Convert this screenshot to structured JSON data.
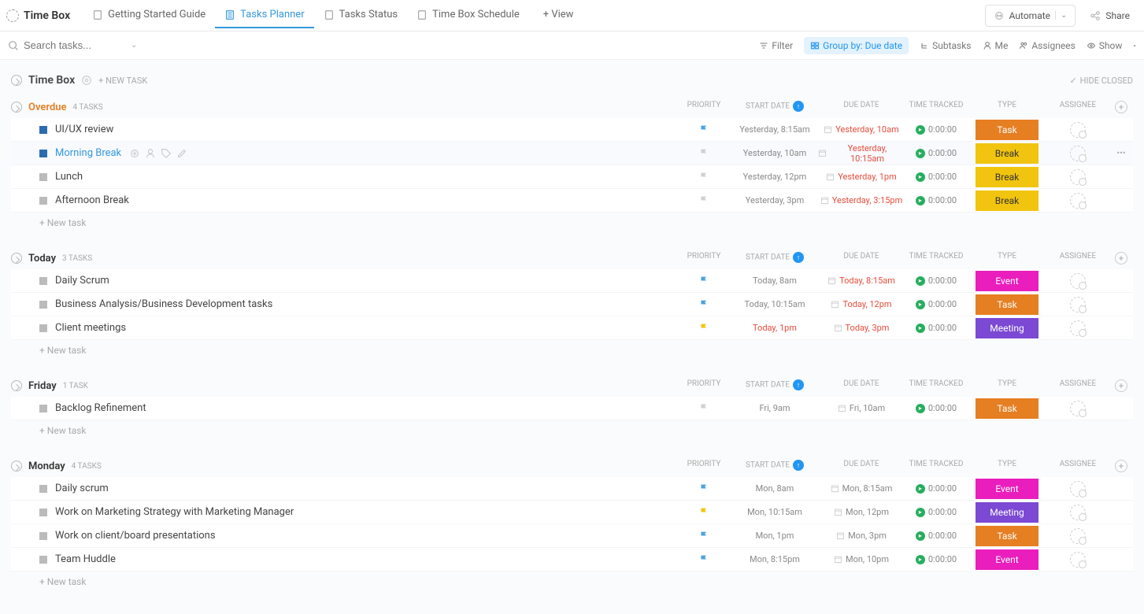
{
  "app": {
    "title": "Time Box"
  },
  "tabs": [
    {
      "label": "Getting Started Guide"
    },
    {
      "label": "Tasks Planner"
    },
    {
      "label": "Tasks Status"
    },
    {
      "label": "Time Box Schedule"
    }
  ],
  "addView": "+ View",
  "topRight": {
    "automate": "Automate",
    "share": "Share"
  },
  "search": {
    "placeholder": "Search tasks..."
  },
  "toolbar": {
    "filter": "Filter",
    "groupBy": "Group by: Due date",
    "subtasks": "Subtasks",
    "me": "Me",
    "assignees": "Assignees",
    "show": "Show"
  },
  "list": {
    "title": "Time Box",
    "newTask": "+ NEW TASK",
    "hideClosed": "HIDE CLOSED"
  },
  "columns": {
    "priority": "PRIORITY",
    "startDate": "START DATE",
    "dueDate": "DUE DATE",
    "timeTracked": "TIME TRACKED",
    "type": "TYPE",
    "assignee": "ASSIGNEE"
  },
  "newTaskRow": "+ New task",
  "groups": [
    {
      "name": "Overdue",
      "nameClass": "overdue",
      "count": "4 TASKS",
      "tasks": [
        {
          "name": "UI/UX review",
          "status": "blue",
          "flag": "blue",
          "start": "Yesterday, 8:15am",
          "due": "Yesterday, 10am",
          "dueRed": true,
          "time": "0:00:00",
          "type": "Task",
          "typeClass": "type-task"
        },
        {
          "name": "Morning Break",
          "status": "blue",
          "flag": "gray",
          "start": "Yesterday, 10am",
          "due": "Yesterday, 10:15am",
          "dueRed": true,
          "time": "0:00:00",
          "type": "Break",
          "typeClass": "type-break",
          "hover": true,
          "actions": true,
          "more": true,
          "link": true
        },
        {
          "name": "Lunch",
          "status": "gray",
          "flag": "gray",
          "start": "Yesterday, 12pm",
          "due": "Yesterday, 1pm",
          "dueRed": true,
          "time": "0:00:00",
          "type": "Break",
          "typeClass": "type-break"
        },
        {
          "name": "Afternoon Break",
          "status": "gray",
          "flag": "gray",
          "start": "Yesterday, 3pm",
          "due": "Yesterday, 3:15pm",
          "dueRed": true,
          "time": "0:00:00",
          "type": "Break",
          "typeClass": "type-break"
        }
      ]
    },
    {
      "name": "Today",
      "count": "3 TASKS",
      "tasks": [
        {
          "name": "Daily Scrum",
          "status": "gray",
          "flag": "blue",
          "start": "Today, 8am",
          "due": "Today, 8:15am",
          "dueRed": true,
          "time": "0:00:00",
          "type": "Event",
          "typeClass": "type-event"
        },
        {
          "name": "Business Analysis/Business Development tasks",
          "status": "gray",
          "flag": "blue",
          "start": "Today, 10:15am",
          "due": "Today, 12pm",
          "dueRed": true,
          "time": "0:00:00",
          "type": "Task",
          "typeClass": "type-task"
        },
        {
          "name": "Client meetings",
          "status": "gray",
          "flag": "yellow",
          "start": "Today, 1pm",
          "startRed": true,
          "due": "Today, 3pm",
          "dueRed": true,
          "time": "0:00:00",
          "type": "Meeting",
          "typeClass": "type-meeting"
        }
      ]
    },
    {
      "name": "Friday",
      "count": "1 TASK",
      "tasks": [
        {
          "name": "Backlog Refinement",
          "status": "gray",
          "flag": "gray",
          "start": "Fri, 9am",
          "due": "Fri, 10am",
          "time": "0:00:00",
          "type": "Task",
          "typeClass": "type-task"
        }
      ]
    },
    {
      "name": "Monday",
      "count": "4 TASKS",
      "tasks": [
        {
          "name": "Daily scrum",
          "status": "gray",
          "flag": "blue",
          "start": "Mon, 8am",
          "due": "Mon, 8:15am",
          "time": "0:00:00",
          "type": "Event",
          "typeClass": "type-event"
        },
        {
          "name": "Work on Marketing Strategy with Marketing Manager",
          "status": "gray",
          "flag": "yellow",
          "start": "Mon, 10:15am",
          "due": "Mon, 12pm",
          "time": "0:00:00",
          "type": "Meeting",
          "typeClass": "type-meeting"
        },
        {
          "name": "Work on client/board presentations",
          "status": "gray",
          "flag": "blue",
          "start": "Mon, 1pm",
          "due": "Mon, 3pm",
          "time": "0:00:00",
          "type": "Task",
          "typeClass": "type-task"
        },
        {
          "name": "Team Huddle",
          "status": "gray",
          "flag": "blue",
          "start": "Mon, 8:15pm",
          "due": "Mon, 10pm",
          "time": "0:00:00",
          "type": "Event",
          "typeClass": "type-event"
        }
      ]
    }
  ]
}
